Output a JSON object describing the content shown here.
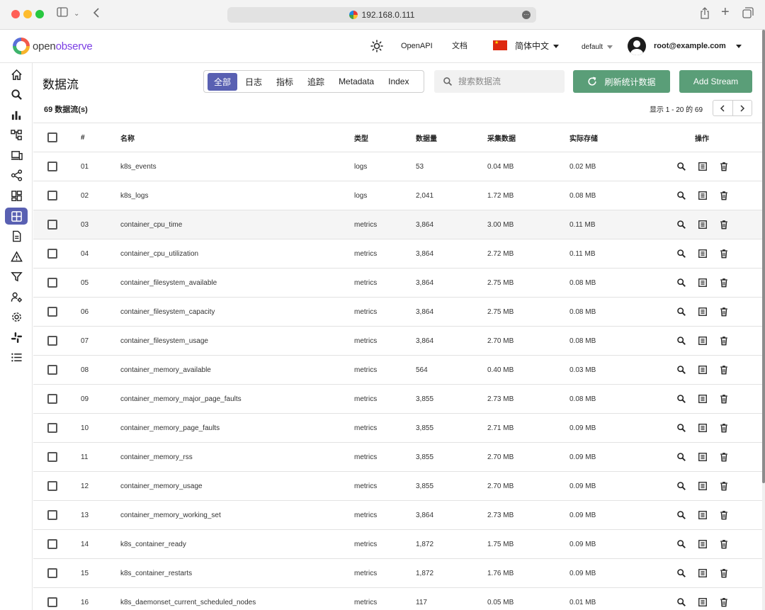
{
  "browser": {
    "url": "192.168.0.111"
  },
  "header": {
    "logo_open": "open",
    "logo_observe": "observe",
    "openapi": "OpenAPI",
    "docs": "文档",
    "language": "简体中文",
    "org": "default",
    "user": "root@example.com"
  },
  "page": {
    "title": "数据流",
    "tabs": [
      "全部",
      "日志",
      "指标",
      "追踪",
      "Metadata",
      "Index"
    ],
    "active_tab": "全部",
    "search_placeholder": "搜索数据流",
    "refresh_label": "刷新统计数据",
    "add_label": "Add Stream",
    "count_label": "69 数据流(s)",
    "pager_label": "显示 1 - 20 的 69"
  },
  "table": {
    "headers": {
      "num": "#",
      "name": "名称",
      "type": "类型",
      "docs": "数据量",
      "ingested": "采集数据",
      "storage": "实际存储",
      "actions": "操作"
    },
    "rows": [
      {
        "num": "01",
        "name": "k8s_events",
        "type": "logs",
        "docs": "53",
        "ingested": "0.04 MB",
        "storage": "0.02 MB"
      },
      {
        "num": "02",
        "name": "k8s_logs",
        "type": "logs",
        "docs": "2,041",
        "ingested": "1.72 MB",
        "storage": "0.08 MB"
      },
      {
        "num": "03",
        "name": "container_cpu_time",
        "type": "metrics",
        "docs": "3,864",
        "ingested": "3.00 MB",
        "storage": "0.11 MB"
      },
      {
        "num": "04",
        "name": "container_cpu_utilization",
        "type": "metrics",
        "docs": "3,864",
        "ingested": "2.72 MB",
        "storage": "0.11 MB"
      },
      {
        "num": "05",
        "name": "container_filesystem_available",
        "type": "metrics",
        "docs": "3,864",
        "ingested": "2.75 MB",
        "storage": "0.08 MB"
      },
      {
        "num": "06",
        "name": "container_filesystem_capacity",
        "type": "metrics",
        "docs": "3,864",
        "ingested": "2.75 MB",
        "storage": "0.08 MB"
      },
      {
        "num": "07",
        "name": "container_filesystem_usage",
        "type": "metrics",
        "docs": "3,864",
        "ingested": "2.70 MB",
        "storage": "0.08 MB"
      },
      {
        "num": "08",
        "name": "container_memory_available",
        "type": "metrics",
        "docs": "564",
        "ingested": "0.40 MB",
        "storage": "0.03 MB"
      },
      {
        "num": "09",
        "name": "container_memory_major_page_faults",
        "type": "metrics",
        "docs": "3,855",
        "ingested": "2.73 MB",
        "storage": "0.08 MB"
      },
      {
        "num": "10",
        "name": "container_memory_page_faults",
        "type": "metrics",
        "docs": "3,855",
        "ingested": "2.71 MB",
        "storage": "0.09 MB"
      },
      {
        "num": "11",
        "name": "container_memory_rss",
        "type": "metrics",
        "docs": "3,855",
        "ingested": "2.70 MB",
        "storage": "0.09 MB"
      },
      {
        "num": "12",
        "name": "container_memory_usage",
        "type": "metrics",
        "docs": "3,855",
        "ingested": "2.70 MB",
        "storage": "0.09 MB"
      },
      {
        "num": "13",
        "name": "container_memory_working_set",
        "type": "metrics",
        "docs": "3,864",
        "ingested": "2.73 MB",
        "storage": "0.09 MB"
      },
      {
        "num": "14",
        "name": "k8s_container_ready",
        "type": "metrics",
        "docs": "1,872",
        "ingested": "1.75 MB",
        "storage": "0.09 MB"
      },
      {
        "num": "15",
        "name": "k8s_container_restarts",
        "type": "metrics",
        "docs": "1,872",
        "ingested": "1.76 MB",
        "storage": "0.09 MB"
      },
      {
        "num": "16",
        "name": "k8s_daemonset_current_scheduled_nodes",
        "type": "metrics",
        "docs": "117",
        "ingested": "0.05 MB",
        "storage": "0.01 MB"
      }
    ]
  },
  "sidebar": {
    "items": [
      "home-icon",
      "search-icon",
      "bar-chart-icon",
      "pipeline-icon",
      "devices-icon",
      "share-icon",
      "dashboard-icon",
      "streams-icon",
      "report-icon",
      "alert-icon",
      "filter-icon",
      "user-settings-icon",
      "settings-icon",
      "slack-icon",
      "list-icon"
    ],
    "active": "streams-icon"
  },
  "colors": {
    "accent": "#5960b2",
    "green": "#5a9e78"
  }
}
